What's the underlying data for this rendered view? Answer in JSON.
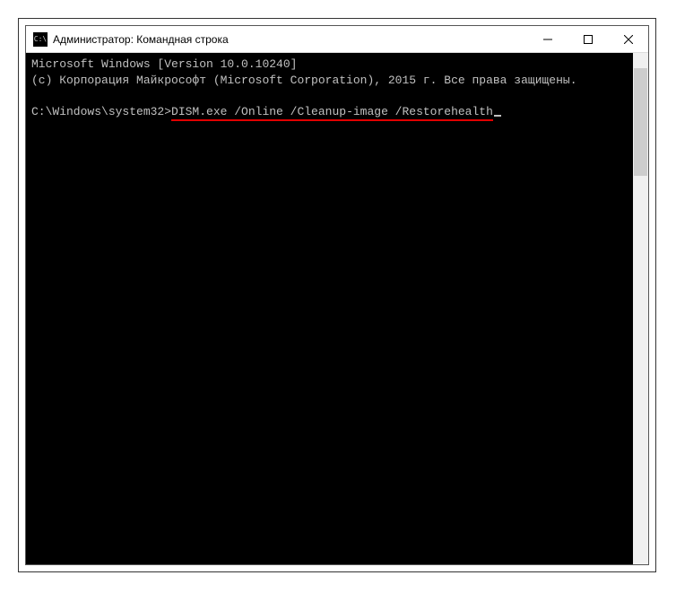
{
  "titlebar": {
    "icon_label": "C:\\",
    "title": "Администратор: Командная строка"
  },
  "terminal": {
    "line1": "Microsoft Windows [Version 10.0.10240]",
    "line2": "(c) Корпорация Майкрософт (Microsoft Corporation), 2015 г. Все права защищены.",
    "prompt": "C:\\Windows\\system32>",
    "command": "DISM.exe /Online /Cleanup-image /Restorehealth"
  }
}
